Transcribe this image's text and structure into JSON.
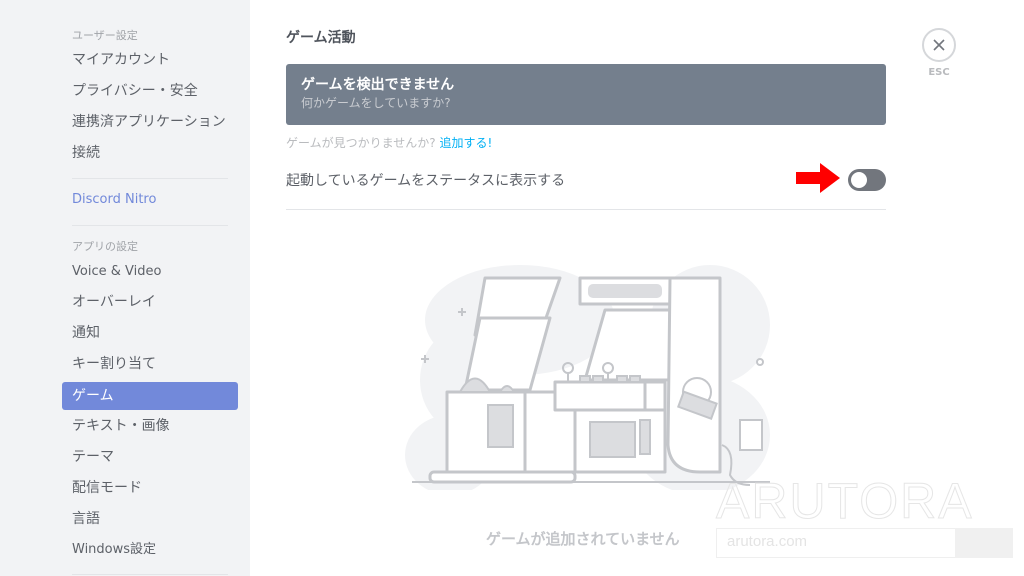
{
  "sidebar": {
    "user_settings_header": "ユーザー設定",
    "user_items": [
      {
        "label": "マイアカウント"
      },
      {
        "label": "プライバシー・安全"
      },
      {
        "label": "連携済アプリケーション"
      },
      {
        "label": "接続"
      }
    ],
    "nitro_label": "Discord Nitro",
    "app_settings_header": "アプリの設定",
    "app_items": [
      {
        "label": "Voice & Video"
      },
      {
        "label": "オーバーレイ"
      },
      {
        "label": "通知"
      },
      {
        "label": "キー割り当て"
      },
      {
        "label": "ゲーム",
        "selected": true
      },
      {
        "label": "テキスト・画像"
      },
      {
        "label": "テーマ"
      },
      {
        "label": "配信モード"
      },
      {
        "label": "言語"
      },
      {
        "label": "Windows設定"
      }
    ]
  },
  "main": {
    "title": "ゲーム活動",
    "banner": {
      "title": "ゲームを検出できません",
      "subtitle": "何かゲームをしていますか?"
    },
    "not_found_text": "ゲームが見つかりませんか?",
    "add_link": "追加する!",
    "status_toggle": {
      "label": "起動しているゲームをステータスに表示する",
      "enabled": false
    },
    "empty_state": "ゲームが追加されていません"
  },
  "close": {
    "icon": "close-icon",
    "label": "ESC"
  },
  "annotation": {
    "arrow_color": "#ff0000"
  },
  "watermark": {
    "brand": "ARUTORA",
    "url": "arutora.com"
  },
  "colors": {
    "accent": "#7289da",
    "banner": "#747f8d",
    "link": "#00b0f4",
    "toggle_off": "#72767d"
  }
}
